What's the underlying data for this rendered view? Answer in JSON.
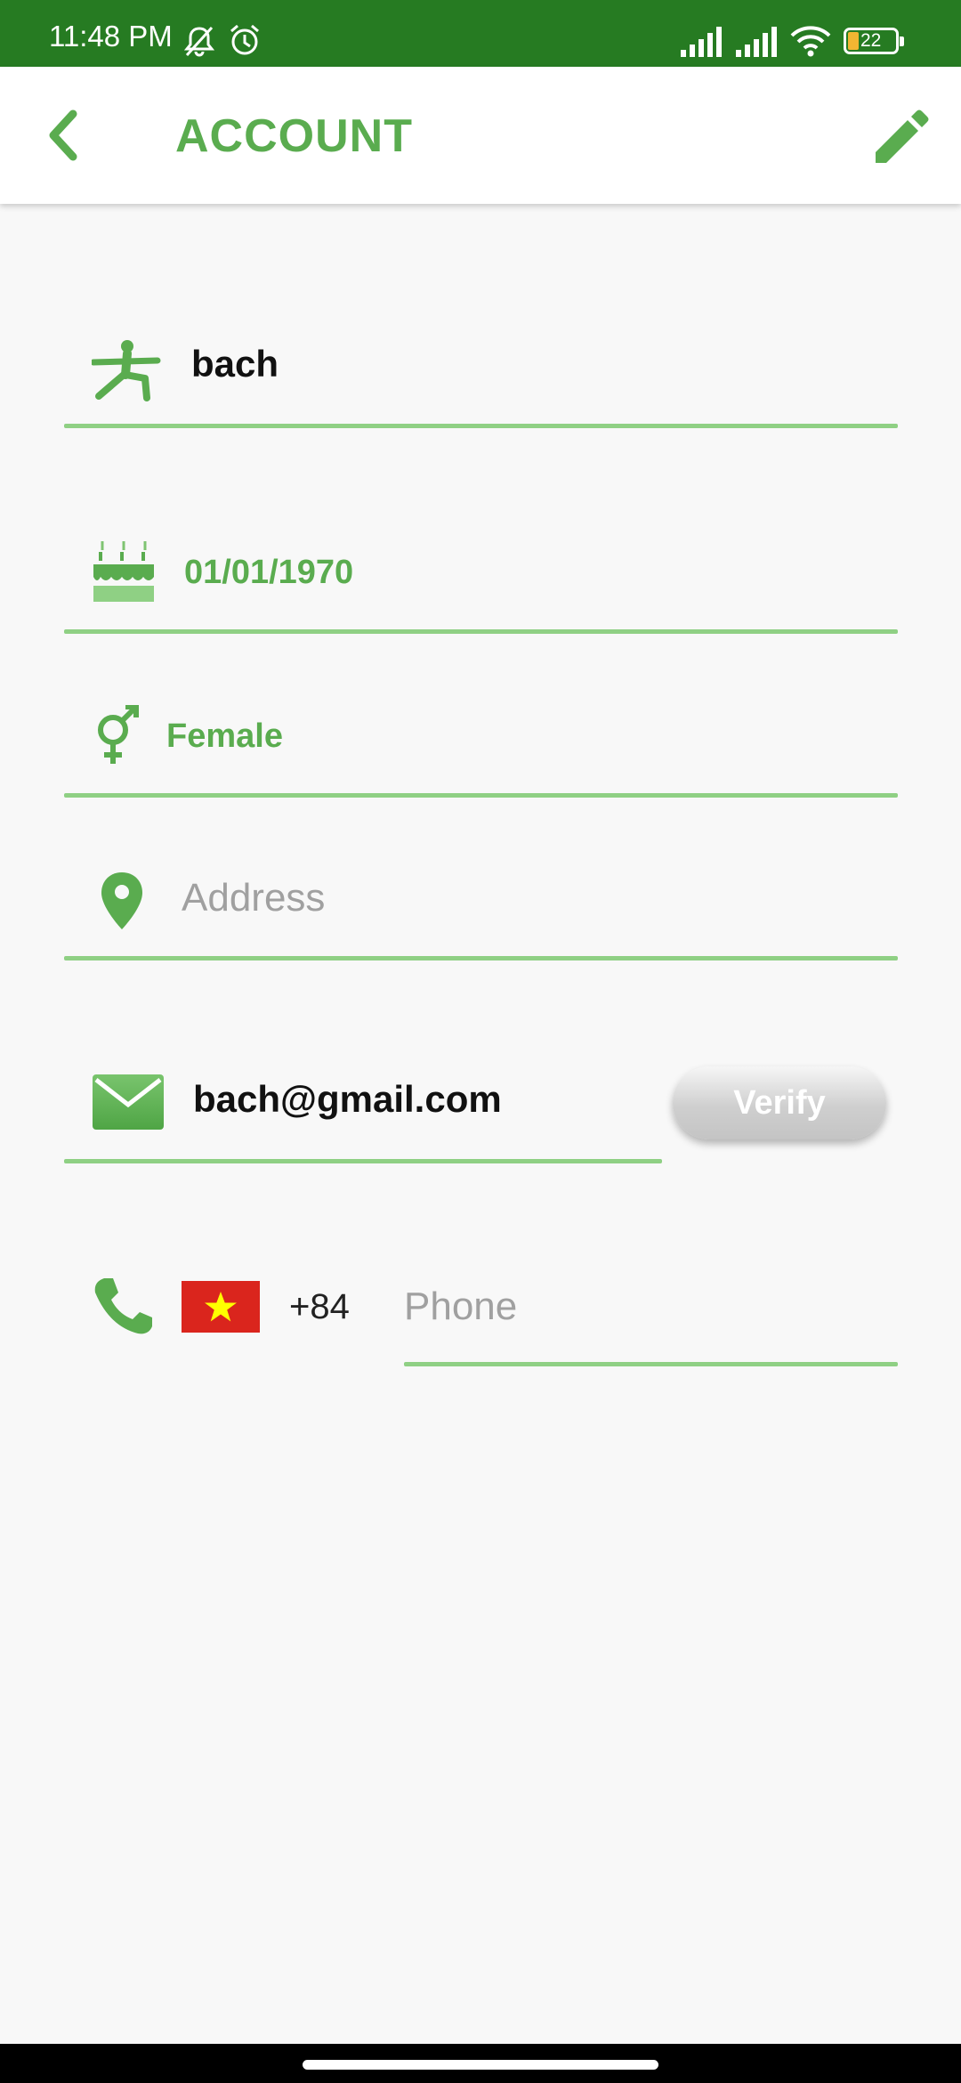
{
  "status_bar": {
    "time": "11:48 PM",
    "battery_level": "22",
    "icons": [
      "bell-off-icon",
      "alarm-icon",
      "signal-icon",
      "signal-icon",
      "wifi-icon",
      "battery-icon"
    ]
  },
  "app_bar": {
    "title": "ACCOUNT",
    "back_icon": "chevron-left-icon",
    "edit_icon": "pencil-icon"
  },
  "form": {
    "name": {
      "icon": "person-stretch-icon",
      "value": "bach"
    },
    "birthday": {
      "icon": "birthday-cake-icon",
      "value": "01/01/1970"
    },
    "gender": {
      "icon": "gender-icon",
      "value": "Female"
    },
    "address": {
      "icon": "location-pin-icon",
      "placeholder": "Address"
    },
    "email": {
      "icon": "mail-icon",
      "value": "bach@gmail.com",
      "verify_label": "Verify"
    },
    "phone": {
      "icon": "phone-icon",
      "flag": "vietnam-flag-icon",
      "country_code": "+84",
      "placeholder": "Phone"
    }
  },
  "colors": {
    "status_bar": "#267b22",
    "accent": "#5aac4f",
    "underline": "#8fd084",
    "background": "#f8f8f8"
  }
}
